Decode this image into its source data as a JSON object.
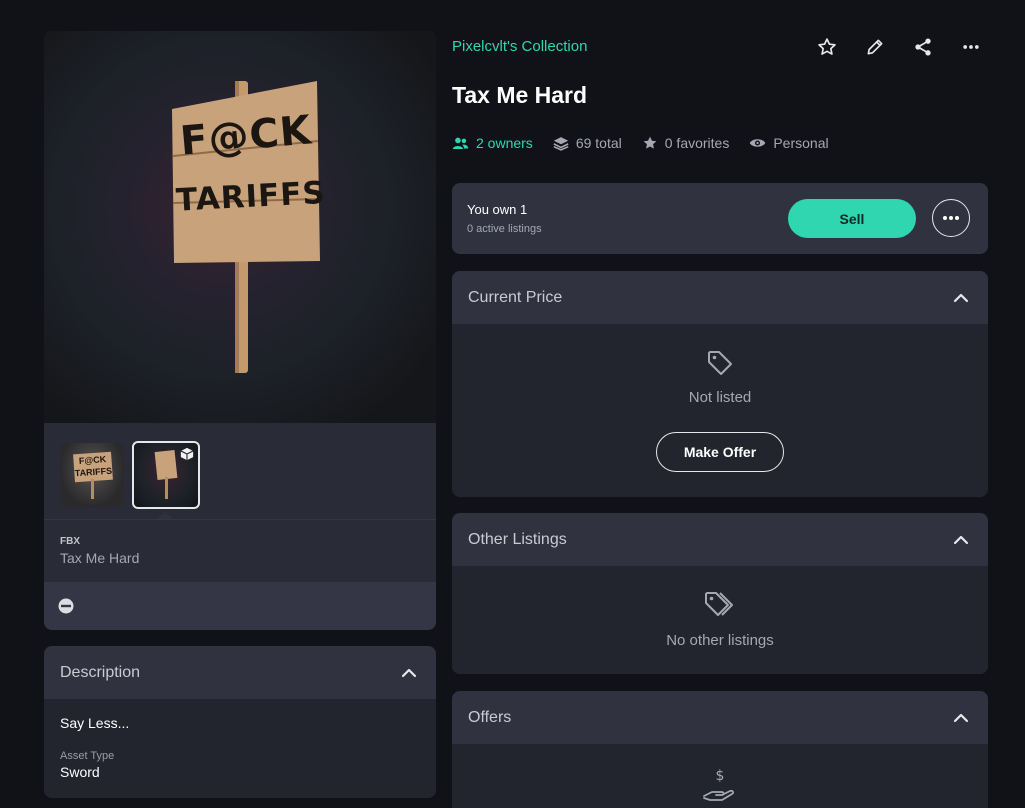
{
  "collection": {
    "name": "Pixelcvlt's Collection"
  },
  "asset": {
    "title": "Tax Me Hard",
    "sign_text_line1": "F@CK",
    "sign_text_line2": "TARIFFS",
    "thumb_text": "F@CK TARIFFS"
  },
  "header_actions": {
    "icons": [
      "star-icon",
      "pencil-icon",
      "share-icon",
      "more-icon"
    ]
  },
  "stats": {
    "owners": "2 owners",
    "total": "69 total",
    "favorites": "0 favorites",
    "visibility": "Personal"
  },
  "file": {
    "format": "FBX",
    "name": "Tax Me Hard"
  },
  "ownership": {
    "you_own": "You own 1",
    "listings": "0 active listings",
    "sell_label": "Sell"
  },
  "current_price": {
    "title": "Current Price",
    "status": "Not listed",
    "offer_label": "Make Offer"
  },
  "other_listings": {
    "title": "Other Listings",
    "empty": "No other listings"
  },
  "offers": {
    "title": "Offers"
  },
  "description": {
    "title": "Description",
    "text": "Say Less...",
    "asset_type_label": "Asset Type",
    "asset_type_value": "Sword"
  },
  "colors": {
    "accent": "#2fd6b0",
    "background": "#111217",
    "panel": "#292b36"
  }
}
